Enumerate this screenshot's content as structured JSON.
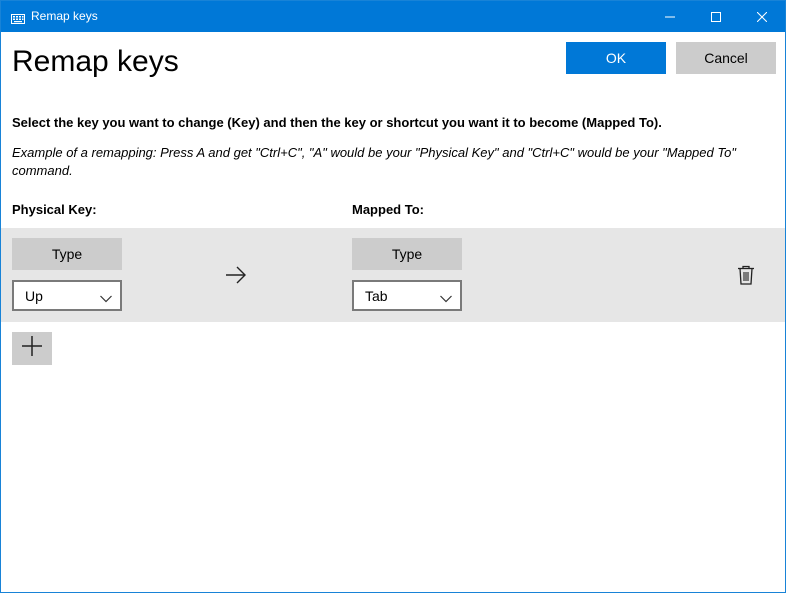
{
  "window": {
    "title": "Remap keys",
    "accent": "#0078d7",
    "title_icon": "keyboard-icon"
  },
  "header": {
    "page_title": "Remap keys",
    "ok_label": "OK",
    "cancel_label": "Cancel"
  },
  "instructions": {
    "main": "Select the key you want to change (Key) and then the key or shortcut you want it to become (Mapped To).",
    "example": "Example of a remapping: Press A and get \"Ctrl+C\", \"A\" would be your \"Physical Key\" and \"Ctrl+C\" would be your \"Mapped To\" command."
  },
  "columns": {
    "physical": "Physical Key:",
    "mapped": "Mapped To:"
  },
  "mappings": [
    {
      "physical_type_label": "Type",
      "physical_value": "Up",
      "mapped_type_label": "Type",
      "mapped_value": "Tab"
    }
  ],
  "icons": {
    "arrow": "arrow-right-icon",
    "delete": "trash-icon",
    "add": "plus-icon"
  }
}
